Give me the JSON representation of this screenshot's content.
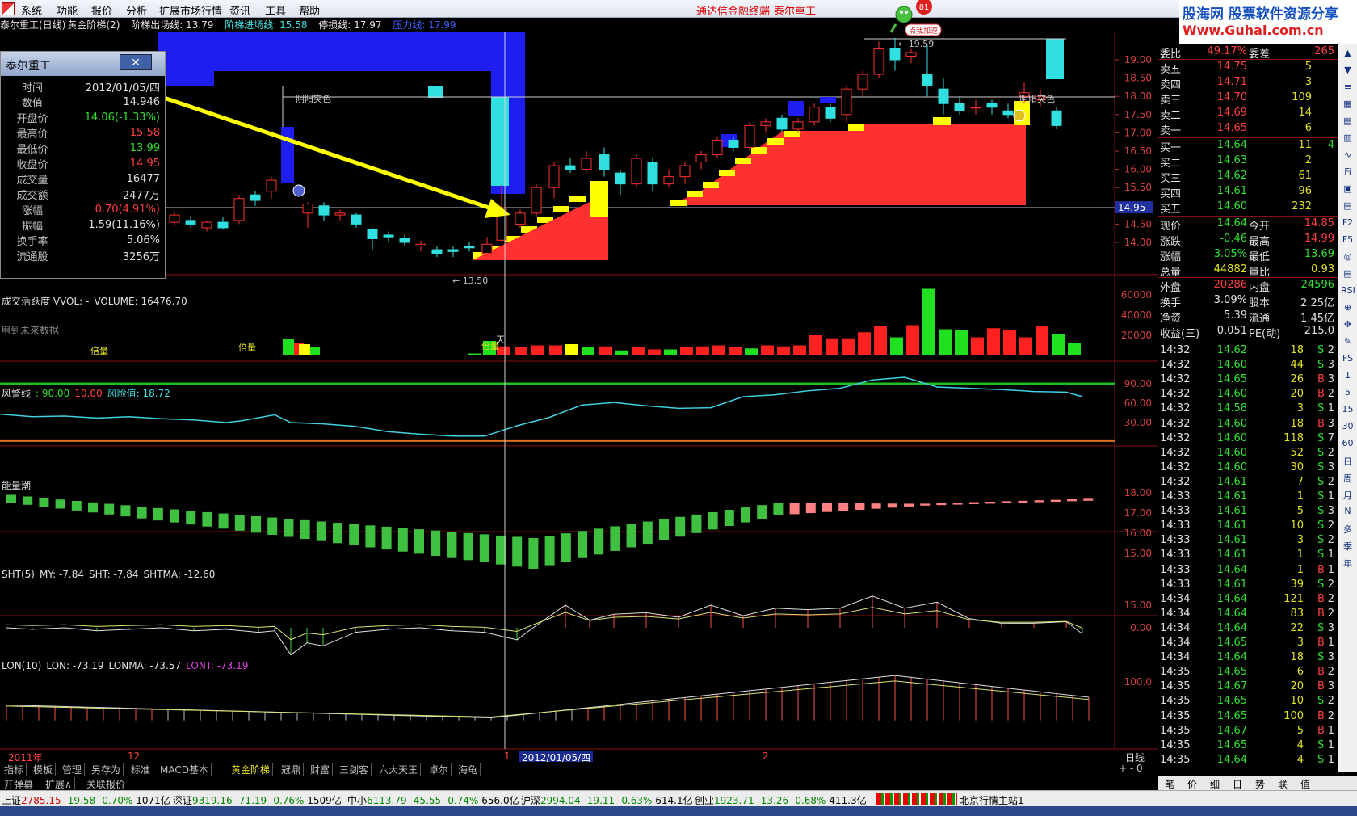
{
  "menubar": {
    "items": [
      "系统",
      "功能",
      "报价",
      "分析",
      "扩展市场行情",
      "资讯",
      "工具",
      "帮助"
    ],
    "brand": "通达信金融终端",
    "stock": "泰尔重工",
    "mascot_badge": "81",
    "mascot_label": "点我加速"
  },
  "logo": {
    "line1": "股海网 股票软件资源分享",
    "line2": "Www.Guhai.com.cn"
  },
  "chart_header": {
    "stock": "泰尔重工(日线)",
    "indicator": "黄金阶梯(2)",
    "exit_label": "阶梯出场线: 13.79",
    "entry_label": "阶梯进场线: 15.58",
    "stop_label": "停损线: 17.97",
    "pressure_label": "压力线: 17.99"
  },
  "colors": {
    "up": "#ff3030",
    "down": "#30e0e0",
    "vol_up": "#ff2020",
    "vol_down": "#20e020",
    "yellow": "#ffff00",
    "blue": "#1e1ef0",
    "grid": "#7a1010",
    "green_bar": "#40c040",
    "pink_bar": "#ff8080"
  },
  "price_axis": [
    "19.00",
    "18.50",
    "18.00",
    "17.50",
    "17.00",
    "16.50",
    "16.00",
    "15.50",
    "15.00",
    "14.50",
    "14.00"
  ],
  "price_current": "14.95",
  "annotations": {
    "low": "13.50",
    "high": "19.59",
    "yin_yang_1": "阴阳突色",
    "yin_yang_2": "阴阳突色",
    "bei_liang": "倍量",
    "tian": "天"
  },
  "popup": {
    "title": "泰尔重工",
    "close": "✕",
    "rows": [
      {
        "k": "时间",
        "v": "2012/01/05/四",
        "c": "wht"
      },
      {
        "k": "数值",
        "v": "14.946",
        "c": "wht"
      },
      {
        "k": "开盘价",
        "v": "14.06(-1.33%)",
        "c": "grn"
      },
      {
        "k": "最高价",
        "v": "15.58",
        "c": "red"
      },
      {
        "k": "最低价",
        "v": "13.99",
        "c": "grn"
      },
      {
        "k": "收盘价",
        "v": "14.95",
        "c": "red"
      },
      {
        "k": "成交量",
        "v": "16477",
        "c": "wht"
      },
      {
        "k": "成交额",
        "v": "2477万",
        "c": "wht"
      },
      {
        "k": "涨幅",
        "v": "0.70(4.91%)",
        "c": "red"
      },
      {
        "k": "振幅",
        "v": "1.59(11.16%)",
        "c": "wht"
      },
      {
        "k": "换手率",
        "v": "5.06%",
        "c": "wht"
      },
      {
        "k": "流通股",
        "v": "3256万",
        "c": "wht"
      }
    ],
    "footer": "用到未来数据"
  },
  "vol_panel": {
    "title": "成交活跃度 VVOL: -",
    "volume": "VOLUME: 16476.70",
    "axis": [
      "60000",
      "40000",
      "20000"
    ]
  },
  "risk_panel": {
    "title": "风警线",
    "v1": ": 90.00",
    "v2": "10.00",
    "risk": "风险值: 18.72",
    "axis": [
      "90.00",
      "60.00",
      "30.00"
    ]
  },
  "energy_panel": {
    "title": "能量潮",
    "axis": [
      "18.00",
      "17.00",
      "16.00",
      "15.00"
    ]
  },
  "sht_panel": {
    "title": "SHT(5)",
    "my": "MY: -7.84",
    "sht": "SHT: -7.84",
    "shtma": "SHTMA: -12.60",
    "axis": [
      "15.00",
      "0.00"
    ]
  },
  "lon_panel": {
    "title": "LON(10)",
    "lon": "LON: -73.19",
    "lonma": "LONMA: -73.57",
    "lont": "LONT: -73.19",
    "axis": [
      "100.0"
    ]
  },
  "date_axis": {
    "left": "2011年",
    "m12": "12",
    "m1": "1",
    "cursor": "2012/01/05/四",
    "m2": "2",
    "period": "日线"
  },
  "quotes": {
    "header": {
      "k1": "委比",
      "v1": "49.17%",
      "k2": "委差",
      "v2": "265"
    },
    "sells": [
      {
        "k": "卖五",
        "p": "14.75",
        "q": "5"
      },
      {
        "k": "卖四",
        "p": "14.71",
        "q": "3"
      },
      {
        "k": "卖三",
        "p": "14.70",
        "q": "109"
      },
      {
        "k": "卖二",
        "p": "14.69",
        "q": "14"
      },
      {
        "k": "卖一",
        "p": "14.65",
        "q": "6"
      }
    ],
    "buys": [
      {
        "k": "买一",
        "p": "14.64",
        "q": "11",
        "d": "-4"
      },
      {
        "k": "买二",
        "p": "14.63",
        "q": "2",
        "d": ""
      },
      {
        "k": "买三",
        "p": "14.62",
        "q": "61",
        "d": ""
      },
      {
        "k": "买四",
        "p": "14.61",
        "q": "96",
        "d": ""
      },
      {
        "k": "买五",
        "p": "14.60",
        "q": "232",
        "d": ""
      }
    ],
    "stats": [
      {
        "k1": "现价",
        "v1": "14.64",
        "c1": "grn",
        "k2": "今开",
        "v2": "14.85",
        "c2": "red"
      },
      {
        "k1": "涨跌",
        "v1": "-0.46",
        "c1": "grn",
        "k2": "最高",
        "v2": "14.99",
        "c2": "red"
      },
      {
        "k1": "涨幅",
        "v1": "-3.05%",
        "c1": "grn",
        "k2": "最低",
        "v2": "13.69",
        "c2": "grn"
      },
      {
        "k1": "总量",
        "v1": "44882",
        "c1": "yel",
        "k2": "量比",
        "v2": "0.93",
        "c2": "yel"
      },
      {
        "k1": "外盘",
        "v1": "20286",
        "c1": "red",
        "k2": "内盘",
        "v2": "24596",
        "c2": "grn"
      },
      {
        "k1": "换手",
        "v1": "3.09%",
        "c1": "wht",
        "k2": "股本",
        "v2": "2.25亿",
        "c2": "wht"
      },
      {
        "k1": "净资",
        "v1": "5.39",
        "c1": "wht",
        "k2": "流通",
        "v2": "1.45亿",
        "c2": "wht"
      },
      {
        "k1": "收益(三)",
        "v1": "0.051",
        "c1": "wht",
        "k2": "PE(动)",
        "v2": "215.0",
        "c2": "wht"
      }
    ],
    "ticks": [
      {
        "t": "14:32",
        "p": "14.62",
        "v": "18",
        "s": "S",
        "n": "2"
      },
      {
        "t": "14:32",
        "p": "14.60",
        "v": "44",
        "s": "S",
        "n": "3"
      },
      {
        "t": "14:32",
        "p": "14.65",
        "v": "26",
        "s": "B",
        "n": "3"
      },
      {
        "t": "14:32",
        "p": "14.60",
        "v": "20",
        "s": "B",
        "n": "2"
      },
      {
        "t": "14:32",
        "p": "14.58",
        "v": "3",
        "s": "S",
        "n": "1"
      },
      {
        "t": "14:32",
        "p": "14.60",
        "v": "18",
        "s": "B",
        "n": "3"
      },
      {
        "t": "14:32",
        "p": "14.60",
        "v": "118",
        "s": "S",
        "n": "7"
      },
      {
        "t": "14:32",
        "p": "14.60",
        "v": "52",
        "s": "S",
        "n": "2"
      },
      {
        "t": "14:32",
        "p": "14.60",
        "v": "30",
        "s": "S",
        "n": "3"
      },
      {
        "t": "14:32",
        "p": "14.61",
        "v": "7",
        "s": "S",
        "n": "2"
      },
      {
        "t": "14:33",
        "p": "14.61",
        "v": "1",
        "s": "S",
        "n": "1"
      },
      {
        "t": "14:33",
        "p": "14.61",
        "v": "5",
        "s": "S",
        "n": "3"
      },
      {
        "t": "14:33",
        "p": "14.61",
        "v": "10",
        "s": "S",
        "n": "2"
      },
      {
        "t": "14:33",
        "p": "14.61",
        "v": "3",
        "s": "S",
        "n": "2"
      },
      {
        "t": "14:33",
        "p": "14.61",
        "v": "1",
        "s": "S",
        "n": "1"
      },
      {
        "t": "14:33",
        "p": "14.64",
        "v": "1",
        "s": "B",
        "n": "1"
      },
      {
        "t": "14:33",
        "p": "14.61",
        "v": "39",
        "s": "S",
        "n": "2"
      },
      {
        "t": "14:34",
        "p": "14.64",
        "v": "121",
        "s": "B",
        "n": "2"
      },
      {
        "t": "14:34",
        "p": "14.64",
        "v": "83",
        "s": "B",
        "n": "2"
      },
      {
        "t": "14:34",
        "p": "14.64",
        "v": "22",
        "s": "S",
        "n": "3"
      },
      {
        "t": "14:34",
        "p": "14.65",
        "v": "3",
        "s": "B",
        "n": "1"
      },
      {
        "t": "14:34",
        "p": "14.64",
        "v": "18",
        "s": "S",
        "n": "3"
      },
      {
        "t": "14:35",
        "p": "14.65",
        "v": "6",
        "s": "B",
        "n": "2"
      },
      {
        "t": "14:35",
        "p": "14.67",
        "v": "20",
        "s": "B",
        "n": "3"
      },
      {
        "t": "14:35",
        "p": "14.65",
        "v": "10",
        "s": "S",
        "n": "2"
      },
      {
        "t": "14:35",
        "p": "14.65",
        "v": "100",
        "s": "B",
        "n": "2"
      },
      {
        "t": "14:35",
        "p": "14.67",
        "v": "5",
        "s": "B",
        "n": "1"
      },
      {
        "t": "14:35",
        "p": "14.65",
        "v": "4",
        "s": "S",
        "n": "1"
      },
      {
        "t": "14:35",
        "p": "14.64",
        "v": "4",
        "s": "S",
        "n": "1"
      }
    ]
  },
  "side_buttons": [
    "▲",
    "▼",
    "≡",
    "▦",
    "▤",
    "▥",
    "∿",
    "Fi",
    "▣",
    "▤",
    "F2",
    "F5",
    "◎",
    "▤",
    "RSI",
    "⊕",
    "✥",
    "✎",
    "FS",
    "1",
    "5",
    "15",
    "30",
    "60",
    "日",
    "周",
    "月",
    "N",
    "多",
    "季",
    "年"
  ],
  "bottom_tabs": [
    "指标",
    "模板",
    "管理",
    "另存为",
    "标准",
    "MACD基本",
    "黄金阶梯",
    "冠鼎",
    "财富",
    "三剑客",
    "六大天王",
    "卓尔",
    "海龟"
  ],
  "bottom_tabs_active": "黄金阶梯",
  "tabs2": [
    "开弹幕",
    "扩展∧",
    "关联报价"
  ],
  "right_tabs": [
    "笔",
    "价",
    "细",
    "日",
    "势",
    "联",
    "值"
  ],
  "status": {
    "sh_label": "上证",
    "sh": "2785.15",
    "sh_chg": "-19.58",
    "sh_pct": "-0.70%",
    "sh_amt": "1071亿",
    "sz_label": "深证",
    "sz": "9319.16",
    "sz_chg": "-71.19",
    "sz_pct": "-0.76%",
    "sz_amt": "1509亿",
    "zx_label": "中小",
    "zx": "6113.79",
    "zx_chg": "-45.55",
    "zx_pct": "-0.74%",
    "zx_amt": "656.0亿",
    "hs_label": "沪深",
    "hs": "2994.04",
    "hs_chg": "-19.11",
    "hs_pct": "-0.63%",
    "hs_amt": "614.1亿",
    "cy_label": "创业",
    "cy": "1923.71",
    "cy_chg": "-13.26",
    "cy_pct": "-0.68%",
    "cy_amt": "411.3亿",
    "station": "北京行情主站1"
  }
}
